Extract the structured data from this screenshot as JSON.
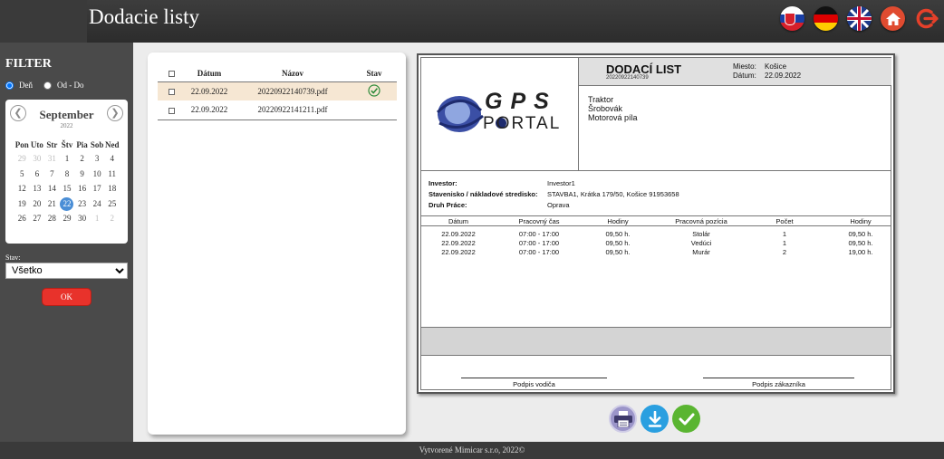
{
  "header": {
    "title": "Dodacie listy",
    "icons": [
      "flag-sk-icon",
      "flag-de-icon",
      "flag-uk-icon",
      "home-icon",
      "logout-icon"
    ]
  },
  "sidebar": {
    "filter_title": "FILTER",
    "radio_day": "Deň",
    "radio_range": "Od - Do",
    "calendar": {
      "month": "September",
      "year": "2022",
      "weekdays": [
        "Pon",
        "Uto",
        "Str",
        "Štv",
        "Pia",
        "Sob",
        "Ned"
      ],
      "days": [
        {
          "d": "29",
          "m": true
        },
        {
          "d": "30",
          "m": true
        },
        {
          "d": "31",
          "m": true
        },
        {
          "d": "1"
        },
        {
          "d": "2"
        },
        {
          "d": "3"
        },
        {
          "d": "4"
        },
        {
          "d": "5"
        },
        {
          "d": "6"
        },
        {
          "d": "7"
        },
        {
          "d": "8"
        },
        {
          "d": "9"
        },
        {
          "d": "10"
        },
        {
          "d": "11"
        },
        {
          "d": "12"
        },
        {
          "d": "13"
        },
        {
          "d": "14"
        },
        {
          "d": "15"
        },
        {
          "d": "16"
        },
        {
          "d": "17"
        },
        {
          "d": "18"
        },
        {
          "d": "19"
        },
        {
          "d": "20"
        },
        {
          "d": "21"
        },
        {
          "d": "22",
          "s": true
        },
        {
          "d": "23"
        },
        {
          "d": "24"
        },
        {
          "d": "25"
        },
        {
          "d": "26"
        },
        {
          "d": "27"
        },
        {
          "d": "28"
        },
        {
          "d": "29"
        },
        {
          "d": "30"
        },
        {
          "d": "1",
          "m": true
        },
        {
          "d": "2",
          "m": true
        }
      ]
    },
    "stav_label": "Stav:",
    "stav_value": "Všetko",
    "ok_label": "OK"
  },
  "file_list": {
    "headers": [
      "Dátum",
      "Názov",
      "Stav"
    ],
    "rows": [
      {
        "date": "22.09.2022",
        "name": "20220922140739.pdf",
        "status": "check"
      },
      {
        "date": "22.09.2022",
        "name": "20220922141211.pdf",
        "status": ""
      }
    ]
  },
  "document": {
    "logo_text": "GPS",
    "logo_sub": "PORTAL",
    "title": "DODACÍ LIST",
    "number": "20220922140739",
    "place_label": "Miesto:",
    "place_value": "Košice",
    "date_label": "Dátum:",
    "date_value": "22.09.2022",
    "items": [
      "Traktor",
      "Šrobovák",
      "Motorová píla"
    ],
    "investor_label": "Investor:",
    "investor_value": "Investor1",
    "site_label": "Stavenisko / nákladové stredisko:",
    "site_value": "STAVBA1, Krátka 179/50, Košice 91953658",
    "work_label": "Druh Práce:",
    "work_value": "Oprava",
    "table_headers": [
      "Dátum",
      "Pracovný čas",
      "Hodiny",
      "Pracovná pozícia",
      "Počet",
      "Hodiny"
    ],
    "table_rows": [
      [
        "22.09.2022",
        "07:00 - 17:00",
        "09,50 h.",
        "Stolár",
        "1",
        "09,50 h."
      ],
      [
        "22.09.2022",
        "07:00 - 17:00",
        "09,50 h.",
        "Vedúci",
        "1",
        "09,50 h."
      ],
      [
        "22.09.2022",
        "07:00 - 17:00",
        "09,50 h.",
        "Murár",
        "2",
        "19,00 h."
      ]
    ],
    "sig_driver": "Podpis vodiča",
    "sig_customer": "Podpis zákazníka"
  },
  "actions": [
    "print-icon",
    "download-icon",
    "confirm-icon"
  ],
  "footer": {
    "text": "Vytvorené Mimicar s.r.o, 2022©"
  }
}
